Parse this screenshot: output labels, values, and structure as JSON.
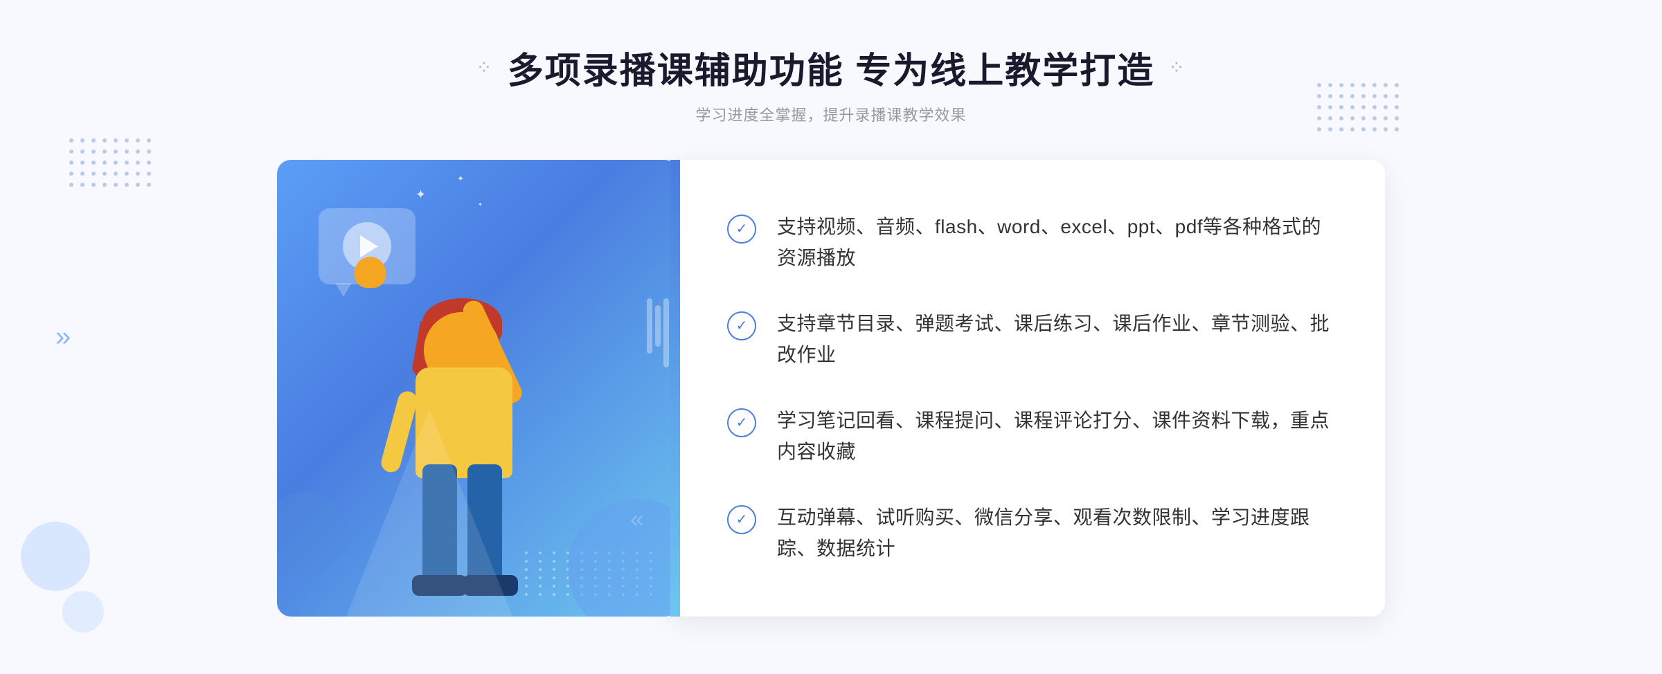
{
  "header": {
    "title": "多项录播课辅助功能 专为线上教学打造",
    "subtitle": "学习进度全掌握，提升录播课教学效果"
  },
  "features": [
    {
      "id": "feature-1",
      "text": "支持视频、音频、flash、word、excel、ppt、pdf等各种格式的资源播放"
    },
    {
      "id": "feature-2",
      "text": "支持章节目录、弹题考试、课后练习、课后作业、章节测验、批改作业"
    },
    {
      "id": "feature-3",
      "text": "学习笔记回看、课程提问、课程评论打分、课件资料下载，重点内容收藏"
    },
    {
      "id": "feature-4",
      "text": "互动弹幕、试听购买、微信分享、观看次数限制、学习进度跟踪、数据统计"
    }
  ],
  "decorators": {
    "left_chevron": "»",
    "check_symbol": "✓"
  },
  "colors": {
    "primary_blue": "#4a7de0",
    "light_blue": "#6ec6f0",
    "gradient_start": "#5b9ef7",
    "text_dark": "#1a1a2e",
    "text_gray": "#999999",
    "text_body": "#333333",
    "white": "#ffffff",
    "bg": "#f8f9ff"
  }
}
